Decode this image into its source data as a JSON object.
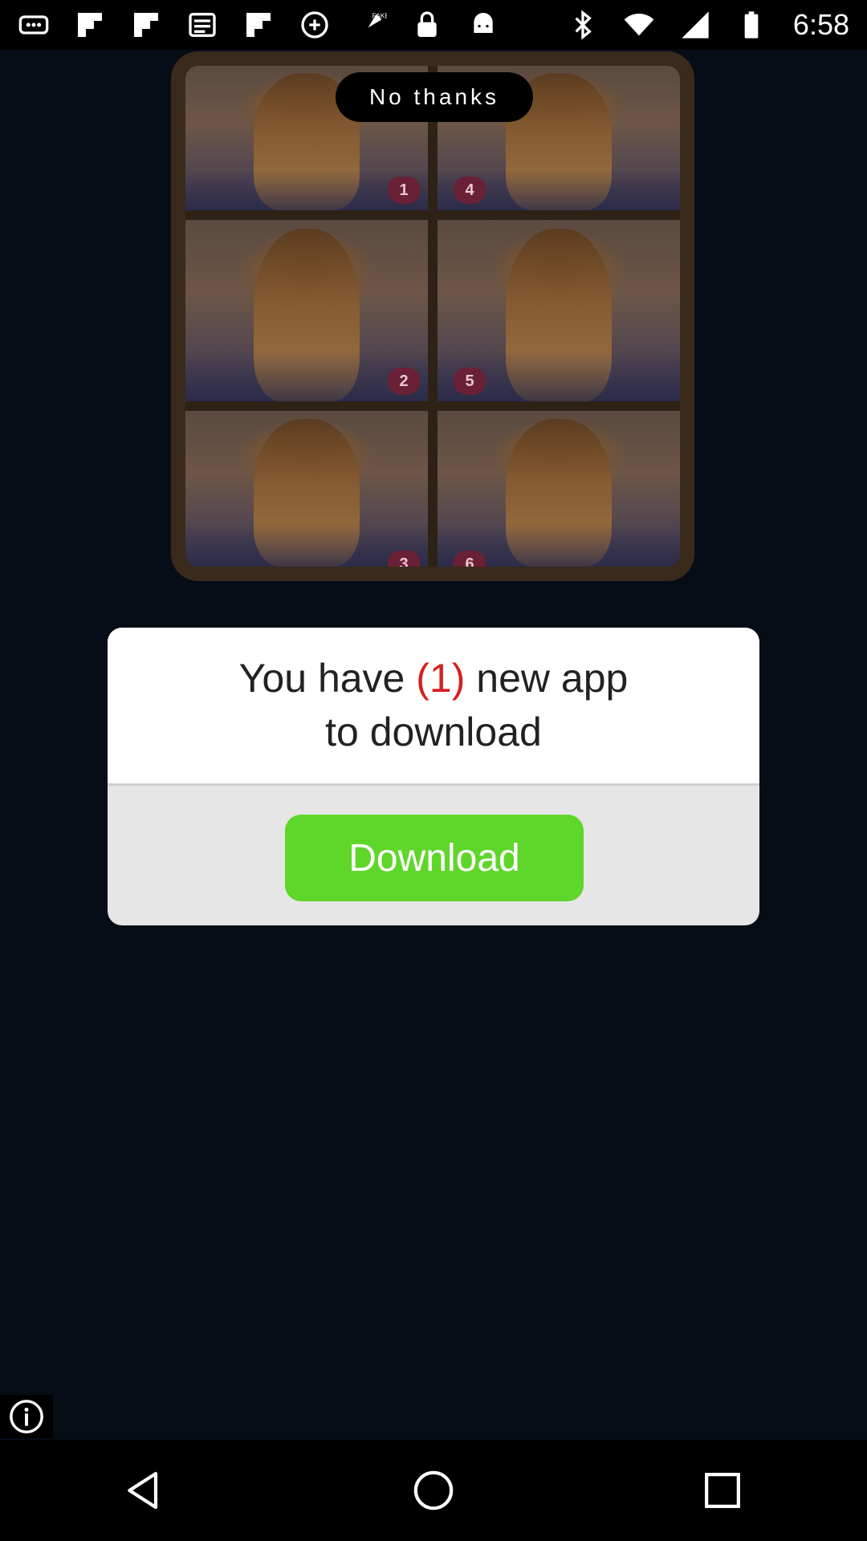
{
  "status_bar": {
    "time": "6:58",
    "left_icons": [
      "more-icon",
      "flipboard-icon",
      "flipboard-icon",
      "inbox-icon",
      "flipboard-icon",
      "sync-icon",
      "fake-gps-icon",
      "lock-icon",
      "android-icon"
    ],
    "right_icons": [
      "bluetooth-icon",
      "wifi-icon",
      "signal-icon",
      "battery-icon"
    ]
  },
  "ad": {
    "dismiss_label": "No thanks",
    "image_alt": "hairstyle tutorial steps",
    "steps": [
      "1",
      "4",
      "2",
      "5",
      "3",
      "6"
    ]
  },
  "dialog": {
    "message_pre": "You have ",
    "message_count": "(1)",
    "message_post": " new app",
    "message_line2": "to download",
    "button_label": "Download",
    "accent_color": "#5fd62a",
    "count_color": "#d42020"
  },
  "nav": {
    "back": "back-icon",
    "home": "home-icon",
    "recents": "recents-icon"
  }
}
